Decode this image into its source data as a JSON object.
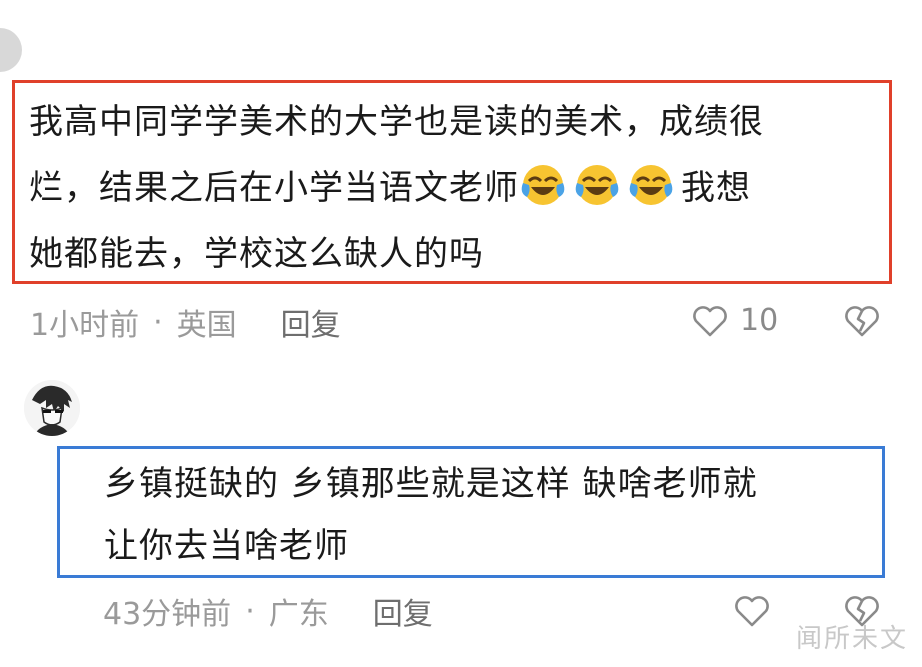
{
  "comment1": {
    "line1": "我高中同学学美术的大学也是读的美术，成绩很",
    "line2_before": "烂，结果之后在小学当语文老师",
    "line2_after": "我想",
    "line3": "她都能去，学校这么缺人的吗",
    "emoji_icon": "rofl-emoji-icon",
    "time": "1小时前",
    "separator": "·",
    "location": "英国",
    "reply_label": "回复",
    "likes": "10"
  },
  "comment2": {
    "line1": "乡镇挺缺的 乡镇那些就是这样 缺啥老师就",
    "line2": "让你去当啥老师",
    "time": "43分钟前",
    "separator": "·",
    "location": "广东",
    "reply_label": "回复"
  },
  "watermark": "闻所未文",
  "colors": {
    "highlight_red": "#e0402a",
    "highlight_blue": "#3a7bd5",
    "meta_gray": "#9a9a9a"
  }
}
